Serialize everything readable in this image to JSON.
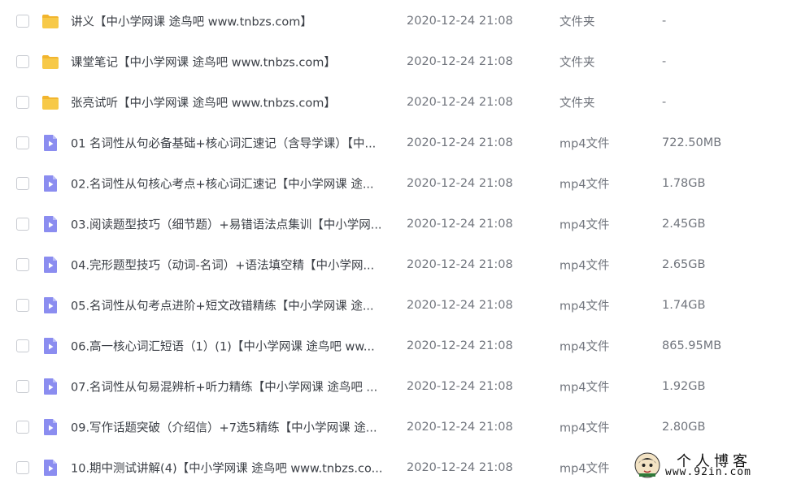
{
  "files": [
    {
      "kind": "folder",
      "icon": "folder-icon",
      "name": "讲义【中小学网课 途鸟吧 www.tnbzs.com】",
      "date": "2020-12-24 21:08",
      "type": "文件夹",
      "size": "-"
    },
    {
      "kind": "folder",
      "icon": "folder-icon",
      "name": "课堂笔记【中小学网课 途鸟吧 www.tnbzs.com】",
      "date": "2020-12-24 21:08",
      "type": "文件夹",
      "size": "-"
    },
    {
      "kind": "folder",
      "icon": "folder-icon",
      "name": "张亮试听【中小学网课 途鸟吧 www.tnbzs.com】",
      "date": "2020-12-24 21:08",
      "type": "文件夹",
      "size": "-"
    },
    {
      "kind": "video",
      "icon": "video-file-icon",
      "name": "01 名词性从句必备基础+核心词汇速记（含导学课）【中...",
      "date": "2020-12-24 21:08",
      "type": "mp4文件",
      "size": "722.50MB"
    },
    {
      "kind": "video",
      "icon": "video-file-icon",
      "name": "02.名词性从句核心考点+核心词汇速记【中小学网课 途...",
      "date": "2020-12-24 21:08",
      "type": "mp4文件",
      "size": "1.78GB"
    },
    {
      "kind": "video",
      "icon": "video-file-icon",
      "name": "03.阅读题型技巧（细节题）+易错语法点集训【中小学网...",
      "date": "2020-12-24 21:08",
      "type": "mp4文件",
      "size": "2.45GB"
    },
    {
      "kind": "video",
      "icon": "video-file-icon",
      "name": "04.完形题型技巧（动词-名词）+语法填空精【中小学网...",
      "date": "2020-12-24 21:08",
      "type": "mp4文件",
      "size": "2.65GB"
    },
    {
      "kind": "video",
      "icon": "video-file-icon",
      "name": "05.名词性从句考点进阶+短文改错精练【中小学网课 途...",
      "date": "2020-12-24 21:08",
      "type": "mp4文件",
      "size": "1.74GB"
    },
    {
      "kind": "video",
      "icon": "video-file-icon",
      "name": "06.高一核心词汇短语（1）(1)【中小学网课 途鸟吧 ww...",
      "date": "2020-12-24 21:08",
      "type": "mp4文件",
      "size": "865.95MB"
    },
    {
      "kind": "video",
      "icon": "video-file-icon",
      "name": "07.名词性从句易混辨析+听力精练【中小学网课 途鸟吧 ...",
      "date": "2020-12-24 21:08",
      "type": "mp4文件",
      "size": "1.92GB"
    },
    {
      "kind": "video",
      "icon": "video-file-icon",
      "name": "09.写作话题突破（介绍信）+7选5精练【中小学网课 途...",
      "date": "2020-12-24 21:08",
      "type": "mp4文件",
      "size": "2.80GB"
    },
    {
      "kind": "video",
      "icon": "video-file-icon",
      "name": "10.期中测试讲解(4)【中小学网课 途鸟吧 www.tnbzs.co...",
      "date": "2020-12-24 21:08",
      "type": "mp4文件",
      "size": ""
    }
  ],
  "watermark": {
    "title": "个人博客",
    "url": "www.92in.com",
    "icon": "avatar-icon"
  },
  "colors": {
    "folder": "#f7c948",
    "folder_tab": "#f2b52e",
    "video_file": "#8b8df0",
    "video_fold": "#b9bbf7",
    "text_primary": "#3b3f46",
    "text_secondary": "#71757d"
  }
}
